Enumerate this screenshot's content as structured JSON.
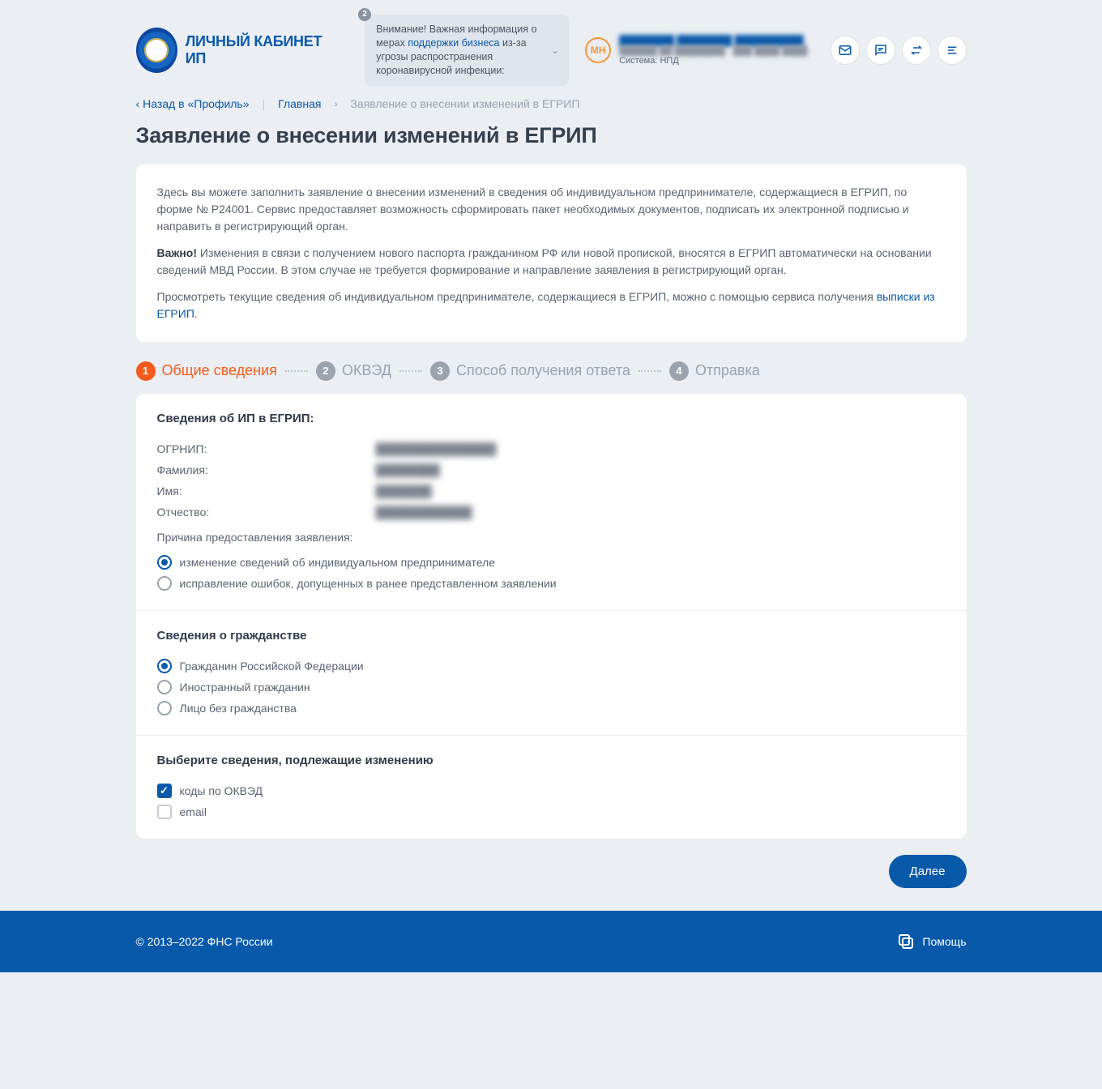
{
  "header": {
    "app_title": "ЛИЧНЫЙ КАБИНЕТ ИП",
    "notif_badge": "2",
    "notif_prefix": "Внимание! Важная информация о мерах ",
    "notif_link": "поддержки бизнеса",
    "notif_suffix": " из-за угрозы распространения коронавирусной инфекции:",
    "avatar": "МН",
    "user_name": "████████ ████████ ██████████",
    "user_line2": "██████ ██ ████████ · ███ ████ ████",
    "user_sys_label": "Система: ",
    "user_sys_value": "НПД"
  },
  "crumb": {
    "back": "Назад в «Профиль»",
    "home": "Главная",
    "current": "Заявление о внесении изменений в ЕГРИП"
  },
  "page_title": "Заявление о внесении изменений в ЕГРИП",
  "info": {
    "p1": "Здесь вы можете заполнить заявление о внесении изменений в сведения об индивидуальном предпринимателе, содержащиеся в ЕГРИП, по форме № Р24001. Сервис предоставляет возможность сформировать пакет необходимых документов, подписать их электронной подписью и направить в регистрирующий орган.",
    "p2_b": "Важно!",
    "p2": " Изменения в связи с получением нового паспорта гражданином РФ или новой пропиской, вносятся в ЕГРИП автоматически на основании сведений МВД России. В этом случае не требуется формирование и направление заявления в регистрирующий орган.",
    "p3_a": "Просмотреть текущие сведения об индивидуальном предпринимателе, содержащиеся в ЕГРИП, можно с помощью сервиса получения ",
    "p3_link": "выписки из ЕГРИП",
    "p3_b": "."
  },
  "steps": {
    "s1": "Общие сведения",
    "s2": "ОКВЭД",
    "s3": "Способ получения ответа",
    "s4": "Отправка"
  },
  "form": {
    "sec1_title": "Сведения об ИП в ЕГРИП:",
    "ogrnip_l": "ОГРНИП:",
    "ogrnip_v": "███████████████",
    "fam_l": "Фамилия:",
    "fam_v": "████████",
    "name_l": "Имя:",
    "name_v": "███████",
    "otch_l": "Отчество:",
    "otch_v": "████████████",
    "reason_label": "Причина предоставления заявления:",
    "reason_opt1": "изменение сведений об индивидуальном предпринимателе",
    "reason_opt2": "исправление ошибок, допущенных в ранее представленном заявлении",
    "sec2_title": "Сведения о гражданстве",
    "cit_opt1": "Гражданин Российской Федерации",
    "cit_opt2": "Иностранный гражданин",
    "cit_opt3": "Лицо без гражданства",
    "sec3_title": "Выберите сведения, подлежащие изменению",
    "chg_opt1": "коды по ОКВЭД",
    "chg_opt2": "email"
  },
  "actions": {
    "next": "Далее"
  },
  "footer": {
    "copyright": "© 2013–2022 ФНС России",
    "help": "Помощь"
  }
}
